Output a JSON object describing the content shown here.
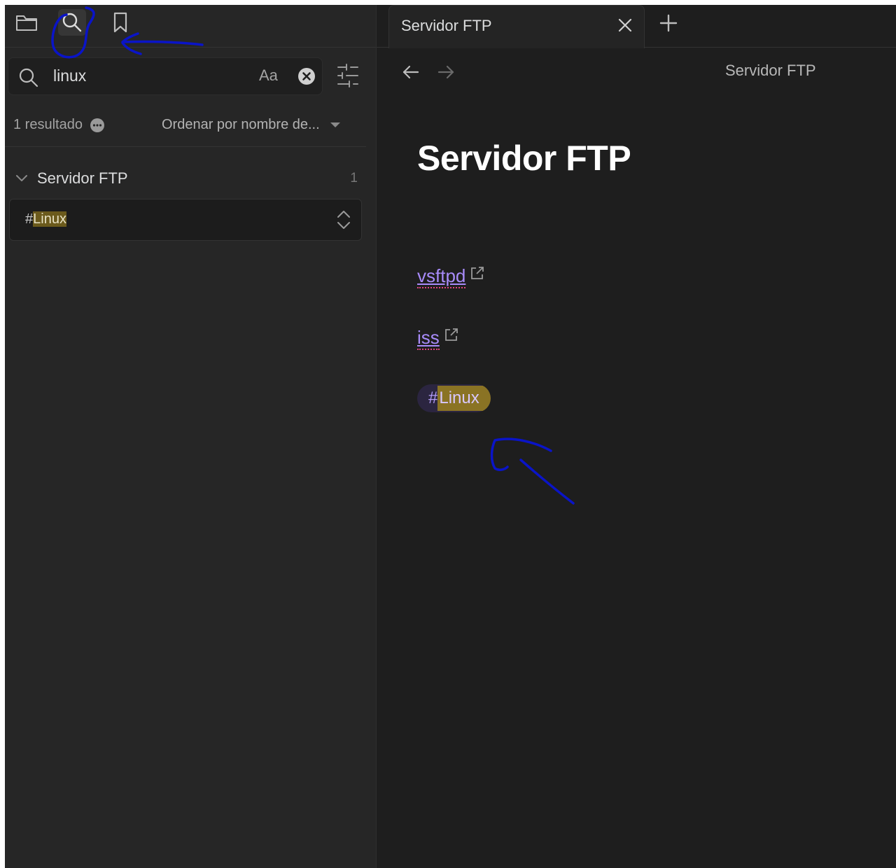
{
  "sidebar": {
    "search": {
      "value": "linux",
      "placeholder": "",
      "match_case_label": "Aa"
    },
    "result_count": "1 resultado",
    "sort_label": "Ordenar por nombre de...",
    "results": [
      {
        "file_title": "Servidor FTP",
        "match_count": "1",
        "match_prefix": "#",
        "match_highlight": "Linux"
      }
    ]
  },
  "tab": {
    "title": "Servidor FTP"
  },
  "nav": {
    "title": "Servidor FTP"
  },
  "document": {
    "title": "Servidor FTP",
    "links": [
      "vsftpd",
      "iss"
    ],
    "tag": {
      "hash": "#",
      "name": "Linux"
    }
  },
  "colors": {
    "accent": "#a88bfa",
    "highlight": "#6b5a1c",
    "annotation": "#0a14c8"
  },
  "icons": [
    "folder-icon",
    "search-icon",
    "bookmark-icon",
    "clear-icon",
    "filter-icon",
    "more-icon",
    "caret-down-icon",
    "chevron-down-icon",
    "expand-icon",
    "close-icon",
    "plus-icon",
    "arrow-left-icon",
    "arrow-right-icon",
    "external-link-icon"
  ]
}
